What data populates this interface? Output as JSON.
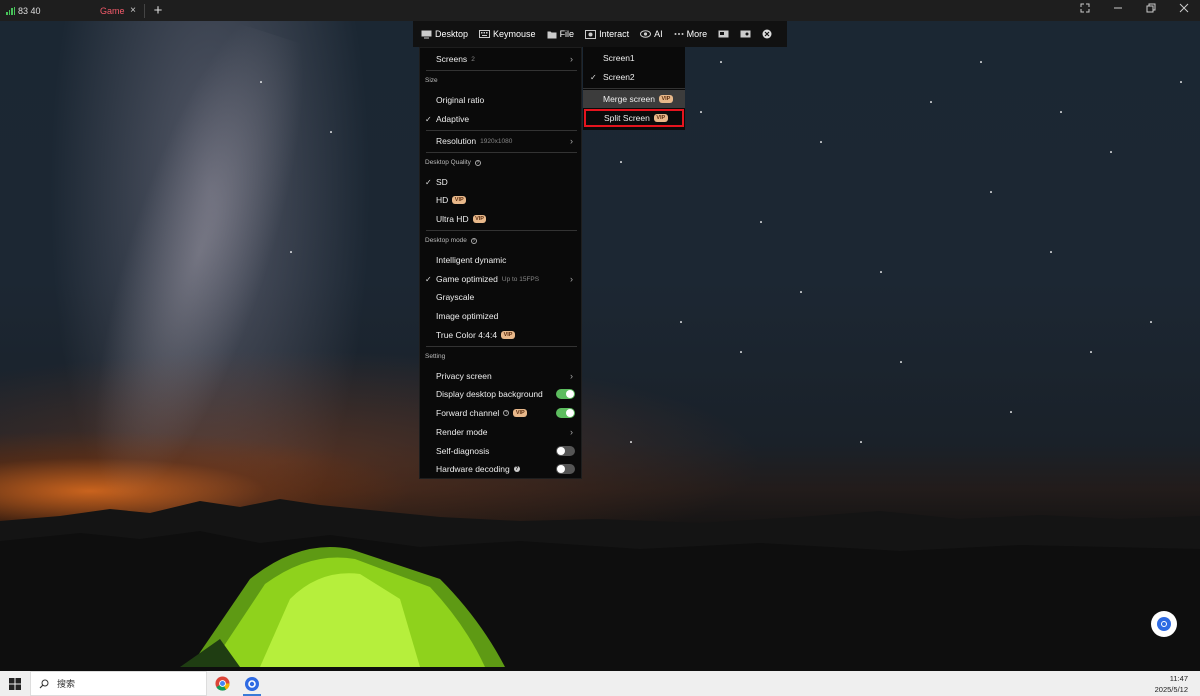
{
  "titlebar": {
    "tabs": [
      {
        "label": "83        40",
        "has_signal": true
      },
      {
        "label": "Game",
        "close": "×"
      }
    ],
    "add_tab": "+"
  },
  "toolbar": {
    "items": [
      {
        "label": "Desktop",
        "icon": "monitor-icon"
      },
      {
        "label": "Keymouse",
        "icon": "keyboard-icon"
      },
      {
        "label": "File",
        "icon": "folder-icon"
      },
      {
        "label": "Interact",
        "icon": "interact-icon"
      },
      {
        "label": "AI",
        "icon": "eye-icon"
      },
      {
        "label": "More",
        "icon": "ellipsis-icon"
      }
    ],
    "extra_icons": [
      "screenshot-icon",
      "record-icon",
      "close-circle-icon"
    ]
  },
  "menu": {
    "screens": {
      "label": "Screens",
      "count": "2"
    },
    "size_header": "Size",
    "size_items": [
      {
        "label": "Original ratio",
        "checked": false
      },
      {
        "label": "Adaptive",
        "checked": true
      }
    ],
    "resolution": {
      "label": "Resolution",
      "value": "1920x1080"
    },
    "quality_header": "Desktop Quality",
    "quality_items": [
      {
        "label": "SD",
        "checked": true,
        "vip": false
      },
      {
        "label": "HD",
        "checked": false,
        "vip": true
      },
      {
        "label": "Ultra HD",
        "checked": false,
        "vip": true
      }
    ],
    "mode_header": "Desktop mode",
    "mode_items": [
      {
        "label": "Intelligent dynamic",
        "checked": false
      },
      {
        "label": "Game optimized",
        "checked": true,
        "sub": "Up to 15FPS"
      },
      {
        "label": "Grayscale",
        "checked": false
      },
      {
        "label": "Image optimized",
        "checked": false
      },
      {
        "label": "True Color 4:4:4",
        "checked": false,
        "vip": true
      }
    ],
    "setting_header": "Setting",
    "settings": {
      "privacy": "Privacy screen",
      "display_bg": "Display desktop background",
      "forward": "Forward channel",
      "render": "Render mode",
      "self_diag": "Self-diagnosis",
      "hw_decode": "Hardware decoding"
    },
    "vip_text": "VIP"
  },
  "submenu": {
    "items": [
      {
        "label": "Screen1",
        "checked": false
      },
      {
        "label": "Screen2",
        "checked": true
      }
    ],
    "merge": "Merge screen",
    "split": "Split Screen"
  },
  "taskbar": {
    "search_text": "搜索",
    "time": "11:47",
    "date": "2025/5/12"
  },
  "colors": {
    "accent_red": "#e5141e",
    "toggle_on": "#5dbd5f",
    "vip_badge": "#e8b88a",
    "game_tab": "#f25a6a"
  }
}
